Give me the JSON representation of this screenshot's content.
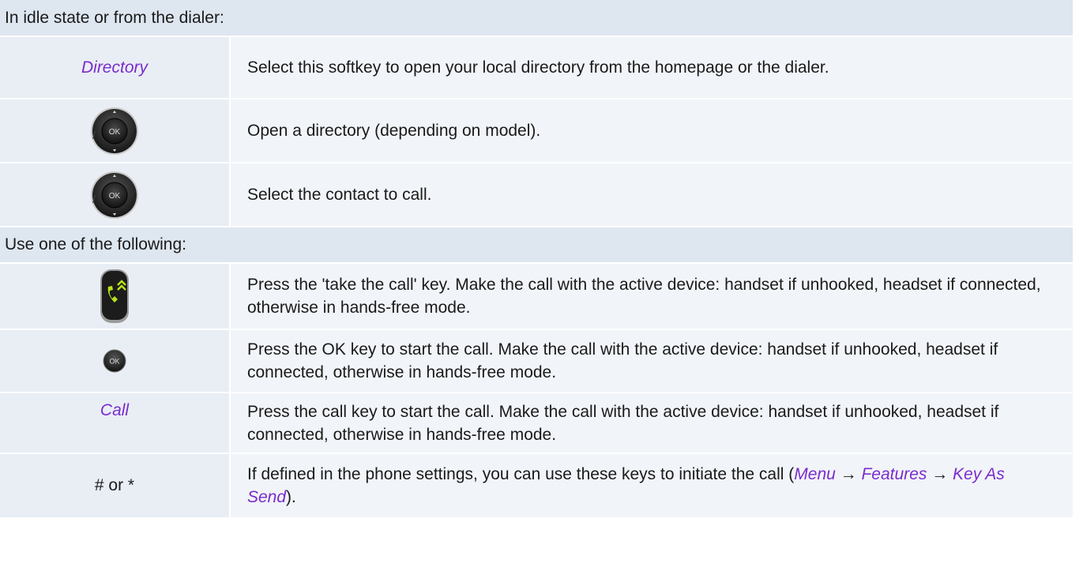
{
  "section1": {
    "header": "In idle state or from the dialer:",
    "rows": [
      {
        "key": "Directory",
        "text": "Select this softkey to open your local directory from the homepage or the dialer."
      },
      {
        "key_icon": "navigator-ok-icon",
        "key_prefix": "/",
        "text": "Open a directory (depending on model)."
      },
      {
        "key_icon": "navigator-ok-icon",
        "key_prefix": "/",
        "text": "Select the contact to call."
      }
    ]
  },
  "section2": {
    "header": "Use one of the following:",
    "rows": [
      {
        "key_icon": "take-call-key-icon",
        "text": "Press the 'take the call' key. Make the call with the active device: handset if unhooked, headset if connected, otherwise in hands-free mode."
      },
      {
        "key_icon": "ok-key-icon",
        "text": "Press the OK key to start the call. Make the call with the active device: handset if unhooked, headset if connected, otherwise in hands-free mode."
      },
      {
        "key": "Call",
        "text": "Press the call key to start the call. Make the call with the active device: handset if unhooked, headset if connected, otherwise in hands-free mode."
      },
      {
        "key": "# or *",
        "text_before": "If defined in the phone settings, you can use these keys to initiate the call (",
        "path": [
          "Menu",
          "Features",
          "Key As Send"
        ],
        "arrow": "→",
        "text_after": ")."
      }
    ]
  },
  "icons": {
    "ok_label": "OK"
  },
  "colors": {
    "accent_purple": "#7a2ccc",
    "header_bg": "#dee6f0",
    "cell_bg": "#f1f4f8",
    "call_key_green": "#b8e21a"
  }
}
